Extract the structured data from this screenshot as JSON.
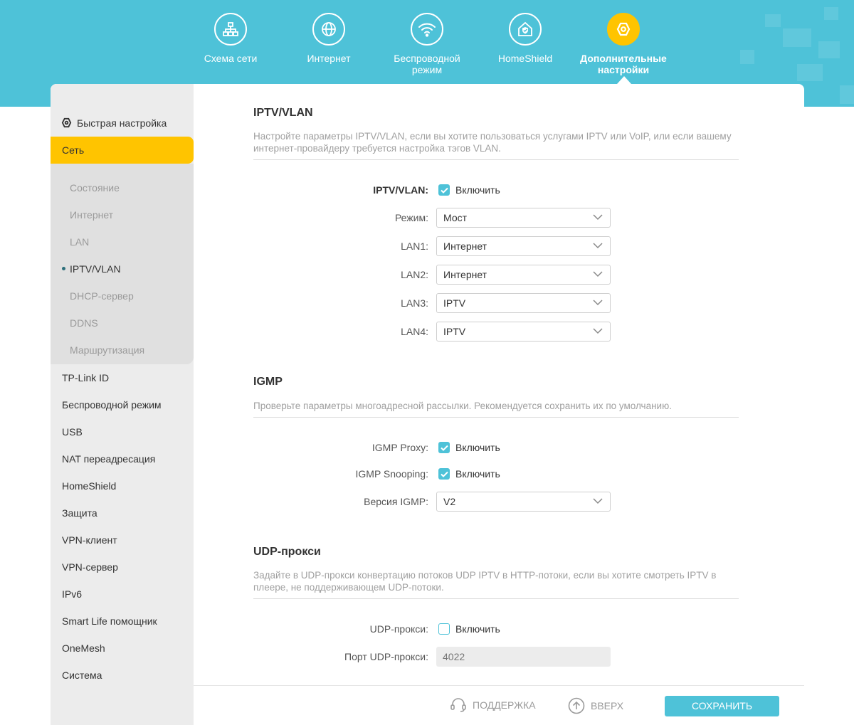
{
  "top_nav": [
    {
      "label": "Схема сети",
      "icon": "network-map-icon"
    },
    {
      "label": "Интернет",
      "icon": "globe-icon"
    },
    {
      "label": "Беспроводной режим",
      "icon": "wifi-icon"
    },
    {
      "label": "HomeShield",
      "icon": "homeshield-icon"
    },
    {
      "label": "Дополнительные настройки",
      "icon": "advanced-gear-icon",
      "active": true
    }
  ],
  "sidebar": {
    "quick_setup": "Быстрая настройка",
    "active_group": "Сеть",
    "sub_items": [
      "Состояние",
      "Интернет",
      "LAN",
      "IPTV/VLAN",
      "DHCP-сервер",
      "DDNS",
      "Маршрутизация"
    ],
    "current_sub": "IPTV/VLAN",
    "items": [
      "TP-Link ID",
      "Беспроводной режим",
      "USB",
      "NAT переадресация",
      "HomeShield",
      "Защита",
      "VPN-клиент",
      "VPN-сервер",
      "IPv6",
      "Smart Life помощник",
      "OneMesh",
      "Система"
    ]
  },
  "iptv": {
    "title": "IPTV/VLAN",
    "description": "Настройте параметры IPTV/VLAN, если вы хотите пользоваться услугами IPTV или VoIP, или если вашему интернет-провайдеру требуется настройка тэгов VLAN.",
    "enable_label": "IPTV/VLAN:",
    "enable_text": "Включить",
    "enabled": true,
    "mode_label": "Режим:",
    "mode_value": "Мост",
    "lan1_label": "LAN1:",
    "lan1_value": "Интернет",
    "lan2_label": "LAN2:",
    "lan2_value": "Интернет",
    "lan3_label": "LAN3:",
    "lan3_value": "IPTV",
    "lan4_label": "LAN4:",
    "lan4_value": "IPTV"
  },
  "igmp": {
    "title": "IGMP",
    "description": "Проверьте параметры многоадресной рассылки. Рекомендуется сохранить их по умолчанию.",
    "proxy_label": "IGMP Proxy:",
    "proxy_text": "Включить",
    "proxy_enabled": true,
    "snooping_label": "IGMP Snooping:",
    "snooping_text": "Включить",
    "snooping_enabled": true,
    "version_label": "Версия IGMP:",
    "version_value": "V2"
  },
  "udp": {
    "title": "UDP-прокси",
    "description": "Задайте в UDP-прокси конвертацию потоков UDP IPTV в HTTP-потоки, если вы хотите смотреть IPTV в плеере, не поддерживающем UDP-потоки.",
    "proxy_label": "UDP-прокси:",
    "proxy_text": "Включить",
    "proxy_enabled": false,
    "port_label": "Порт UDP-прокси:",
    "port_placeholder": "4022"
  },
  "footer": {
    "support": "ПОДДЕРЖКА",
    "top": "ВВЕРХ",
    "save": "СОХРАНИТЬ"
  },
  "colors": {
    "accent": "#4ec2d8",
    "active": "#ffc400"
  }
}
